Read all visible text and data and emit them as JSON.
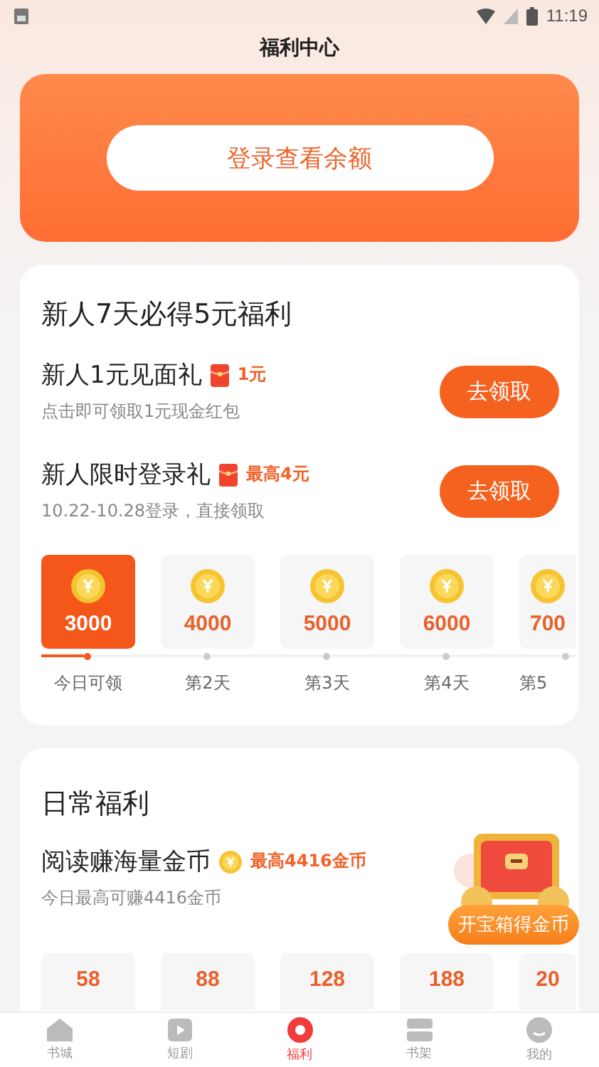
{
  "status_bar": {
    "time": "11:19"
  },
  "title": "福利中心",
  "login_button": "登录查看余额",
  "newcomer": {
    "title": "新人7天必得5元福利",
    "offers": [
      {
        "title": "新人1元见面礼",
        "badge": {
          "kind": "envelope",
          "text": "1元"
        },
        "subtitle": "点击即可领取1元现金红包",
        "button": "去领取"
      },
      {
        "title": "新人限时登录礼",
        "badge": {
          "kind": "envelope",
          "text": "最高4元"
        },
        "subtitle": "10.22-10.28登录，直接领取",
        "button": "去领取"
      }
    ],
    "days": [
      {
        "amount": "3000",
        "label": "今日可领",
        "selected": true
      },
      {
        "amount": "4000",
        "label": "第2天",
        "selected": false
      },
      {
        "amount": "5000",
        "label": "第3天",
        "selected": false
      },
      {
        "amount": "6000",
        "label": "第4天",
        "selected": false
      },
      {
        "amount": "700",
        "label": "第5",
        "selected": false
      }
    ]
  },
  "daily": {
    "title": "日常福利",
    "task": {
      "title": "阅读赚海量金币",
      "badge": {
        "kind": "coin",
        "text": "最高4416金币"
      },
      "subtitle": "今日最高可赚4416金币"
    },
    "rewards": [
      "58",
      "88",
      "128",
      "188",
      "20"
    ]
  },
  "chest": {
    "label": "开宝箱得金币"
  },
  "nav": [
    {
      "label": "书城",
      "selected": false
    },
    {
      "label": "短剧",
      "selected": false
    },
    {
      "label": "福利",
      "selected": true
    },
    {
      "label": "书架",
      "selected": false
    },
    {
      "label": "我的",
      "selected": false
    }
  ]
}
